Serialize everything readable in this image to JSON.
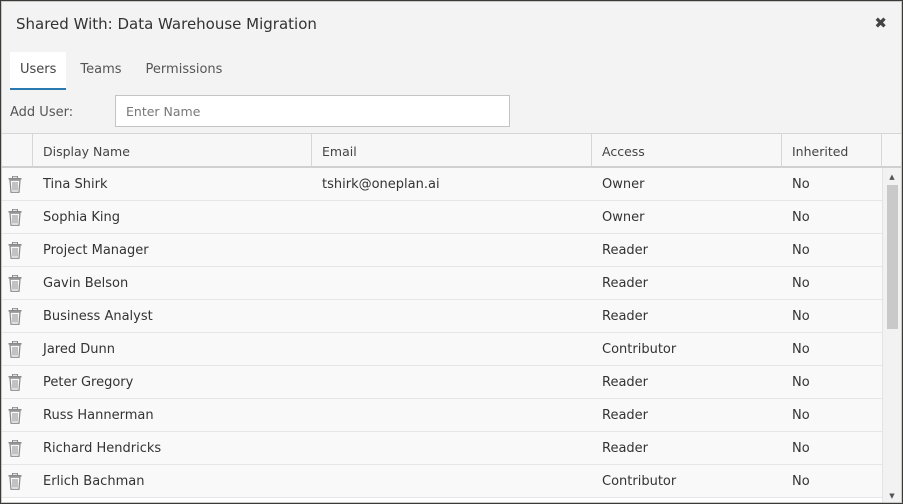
{
  "dialog": {
    "title": "Shared With: Data Warehouse Migration",
    "close_glyph": "✖"
  },
  "tabs": [
    {
      "label": "Users",
      "active": true
    },
    {
      "label": "Teams",
      "active": false
    },
    {
      "label": "Permissions",
      "active": false
    }
  ],
  "add_user": {
    "label": "Add User:",
    "placeholder": "Enter Name",
    "value": ""
  },
  "table": {
    "columns": [
      "",
      "Display Name",
      "Email",
      "Access",
      "Inherited"
    ],
    "rows": [
      {
        "name": "Tina Shirk",
        "email": "tshirk@oneplan.ai",
        "access": "Owner",
        "inherited": "No"
      },
      {
        "name": "Sophia King",
        "email": "",
        "access": "Owner",
        "inherited": "No"
      },
      {
        "name": "Project Manager",
        "email": "",
        "access": "Reader",
        "inherited": "No"
      },
      {
        "name": "Gavin Belson",
        "email": "",
        "access": "Reader",
        "inherited": "No"
      },
      {
        "name": "Business Analyst",
        "email": "",
        "access": "Reader",
        "inherited": "No"
      },
      {
        "name": "Jared Dunn",
        "email": "",
        "access": "Contributor",
        "inherited": "No"
      },
      {
        "name": "Peter Gregory",
        "email": "",
        "access": "Reader",
        "inherited": "No"
      },
      {
        "name": "Russ Hannerman",
        "email": "",
        "access": "Reader",
        "inherited": "No"
      },
      {
        "name": "Richard Hendricks",
        "email": "",
        "access": "Reader",
        "inherited": "No"
      },
      {
        "name": "Erlich Bachman",
        "email": "",
        "access": "Contributor",
        "inherited": "No"
      }
    ]
  },
  "icons": {
    "row_action": "trash-icon",
    "close": "close-icon"
  },
  "colors": {
    "tab_active_underline": "#2a7ab0",
    "dialog_bg": "#f3f3f3"
  }
}
